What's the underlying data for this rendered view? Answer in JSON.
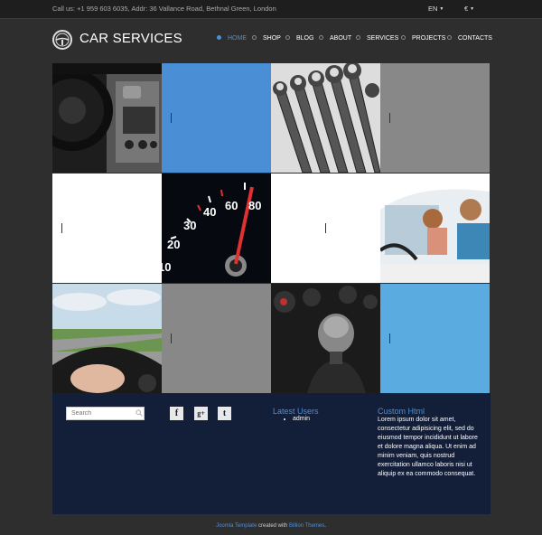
{
  "topbar": {
    "contact": "Call us: +1 959 603 6035, Addr: 36 Vallance Road, Bethnal Green, London",
    "language": "EN",
    "currency": "€"
  },
  "header": {
    "logo_text": "CAR SERVICES",
    "nav": [
      "HOME",
      "SHOP",
      "BLOG",
      "ABOUT",
      "SERVICES",
      "PROJECTS",
      "CONTACTS"
    ],
    "active": "HOME"
  },
  "grid": {
    "tiles": [
      {
        "kind": "photo",
        "subject": "car-dashboard"
      },
      {
        "kind": "color",
        "color": "#4a8fd6"
      },
      {
        "kind": "photo",
        "subject": "wrenches"
      },
      {
        "kind": "color",
        "color": "#888888"
      },
      {
        "kind": "color",
        "color": "#ffffff"
      },
      {
        "kind": "photo",
        "subject": "speedometer"
      },
      {
        "kind": "color",
        "color": "#ffffff"
      },
      {
        "kind": "photo",
        "subject": "couple-in-car"
      },
      {
        "kind": "photo",
        "subject": "driving-road"
      },
      {
        "kind": "color",
        "color": "#888888"
      },
      {
        "kind": "photo",
        "subject": "gear-shift"
      },
      {
        "kind": "color",
        "color": "#5aace0"
      }
    ],
    "speedo_labels": [
      "10",
      "20",
      "30",
      "40",
      "60",
      "80"
    ]
  },
  "footer": {
    "search_placeholder": "Search",
    "social": [
      "f",
      "g+",
      "t"
    ],
    "latest_users_title": "Latest Users",
    "latest_users": [
      "admin"
    ],
    "custom_title": "Custom Html",
    "custom_text": "Lorem ipsum dolor sit amet, consectetur adipisicing elit, sed do eiusmod tempor incididunt ut labore et dolore magna aliqua. Ut enim ad minim veniam, quis nostrud exercitation ullamco laboris nisi ut aliquip ex ea commodo consequat."
  },
  "credit": {
    "link1": "Joomla Template",
    "middle": " created with ",
    "link2": "Billion Themes",
    "end": "."
  },
  "colors": {
    "accent": "#4a90d9",
    "footer_bg": "#131e38",
    "page_bg": "#2e2e2e"
  }
}
